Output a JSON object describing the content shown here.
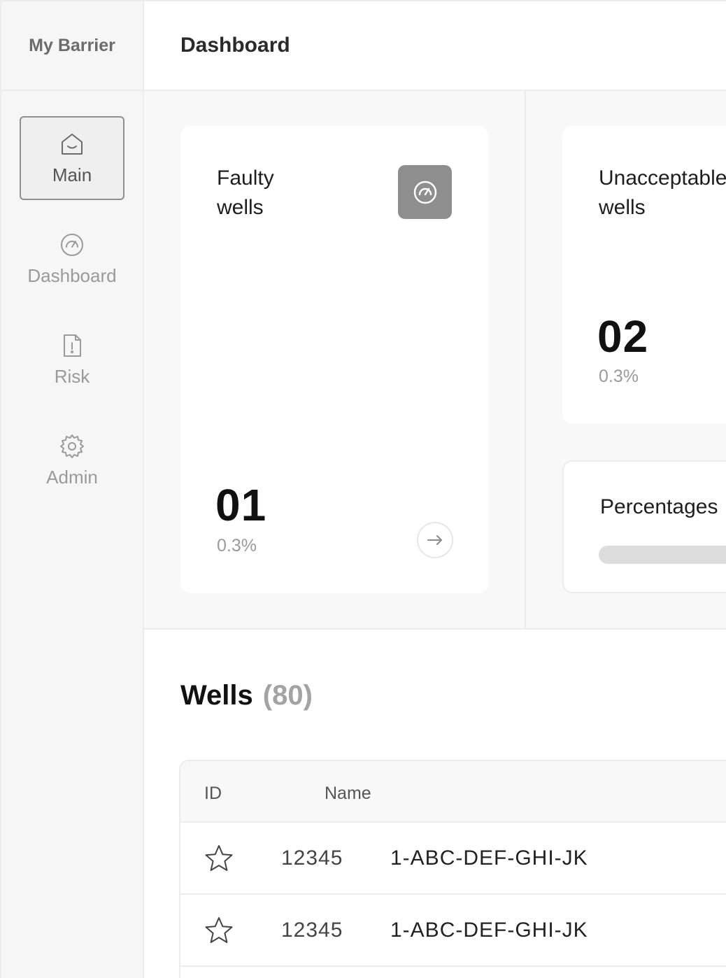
{
  "brand": "My Barrier",
  "header": {
    "title": "Dashboard"
  },
  "sidebar": {
    "items": [
      {
        "label": "Main",
        "icon": "home-icon",
        "active": true
      },
      {
        "label": "Dashboard",
        "icon": "gauge-icon",
        "active": false
      },
      {
        "label": "Risk",
        "icon": "file-alert-icon",
        "active": false
      },
      {
        "label": "Admin",
        "icon": "gear-icon",
        "active": false
      }
    ]
  },
  "cards": {
    "faulty": {
      "title": "Faulty\nwells",
      "value": "01",
      "percent": "0.3%",
      "icon": "gauge-icon"
    },
    "unacceptable": {
      "title": "Unacceptable\nwells",
      "value": "02",
      "percent": "0.3%"
    },
    "percentages": {
      "title": "Percentages"
    }
  },
  "wells": {
    "title": "Wells",
    "count": "(80)",
    "columns": {
      "id": "ID",
      "name": "Name"
    },
    "rows": [
      {
        "id": "12345",
        "name": "1-ABC-DEF-GHI-JK"
      },
      {
        "id": "12345",
        "name": "1-ABC-DEF-GHI-JK"
      }
    ]
  },
  "colors": {
    "sidebar_bg": "#f6f6f6",
    "badge_bg": "#8e8e8e",
    "muted_text": "#9a9a9a"
  }
}
